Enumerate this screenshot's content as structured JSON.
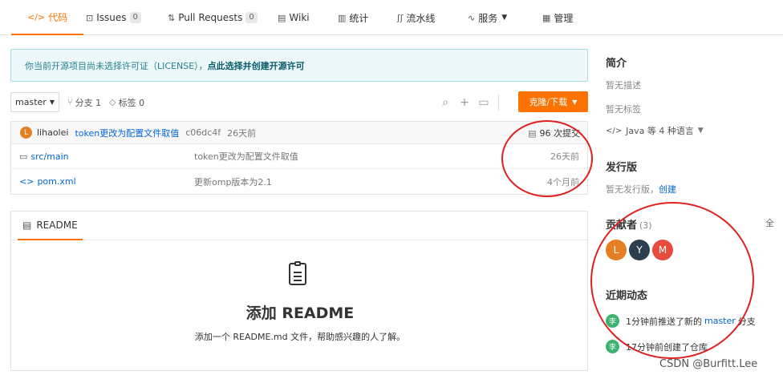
{
  "tabs": [
    {
      "icon": "</>",
      "label": "代码",
      "active": true
    },
    {
      "icon": "⊡",
      "label": "Issues",
      "count": "0"
    },
    {
      "icon": "⇅",
      "label": "Pull Requests",
      "count": "0"
    },
    {
      "icon": "▤",
      "label": "Wiki"
    },
    {
      "icon": "▥",
      "label": "统计"
    },
    {
      "icon": "ʃʃ",
      "label": "流水线"
    },
    {
      "icon": "∿",
      "label": "服务",
      "dropdown": true
    },
    {
      "icon": "▦",
      "label": "管理"
    }
  ],
  "notice": {
    "text": "你当前开源项目尚未选择许可证（LICENSE），",
    "link": "点此选择并创建开源许可"
  },
  "branch": {
    "current": "master",
    "branches": "分支 1",
    "tags": "标签 0"
  },
  "toolbar": {
    "clone_label": "克隆/下载"
  },
  "latest_commit": {
    "avatar_letter": "L",
    "author": "lihaolei",
    "message": "token更改为配置文件取值",
    "hash": "c06dc4f",
    "time": "26天前",
    "total": "96 次提交"
  },
  "files": [
    {
      "icon": "folder-icon",
      "name": "src/main",
      "commit": "token更改为配置文件取值",
      "time": "26天前"
    },
    {
      "icon": "code-icon",
      "name": "pom.xml",
      "commit": "更新omp版本为2.1",
      "time": "4个月前"
    }
  ],
  "readme": {
    "tab_label": "README",
    "title": "添加 README",
    "desc": "添加一个 README.md 文件，帮助感兴趣的人了解。"
  },
  "sidebar": {
    "intro_title": "简介",
    "intro_desc": "暂无描述",
    "tags_text": "暂无标签",
    "lang_text": "Java 等 4 种语言",
    "release_title": "发行版",
    "release_text": "暂无发行版，",
    "release_link": "创建",
    "contrib_title": "贡献者",
    "contrib_count": "(3)",
    "all_link": "全",
    "contributors": [
      {
        "letter": "L",
        "color": "#e67e22"
      },
      {
        "letter": "Y",
        "color": "#2c3e50"
      },
      {
        "letter": "M",
        "color": "#e74c3c"
      }
    ],
    "activity_title": "近期动态",
    "activities": [
      {
        "avatar": "李",
        "pre": "1分钟前推送了新的",
        "branch": "master",
        "post": "分支"
      },
      {
        "avatar": "李",
        "pre": "17分钟前创建了仓库",
        "branch": "",
        "post": ""
      }
    ]
  },
  "watermark": "CSDN @Burfitt.Lee"
}
